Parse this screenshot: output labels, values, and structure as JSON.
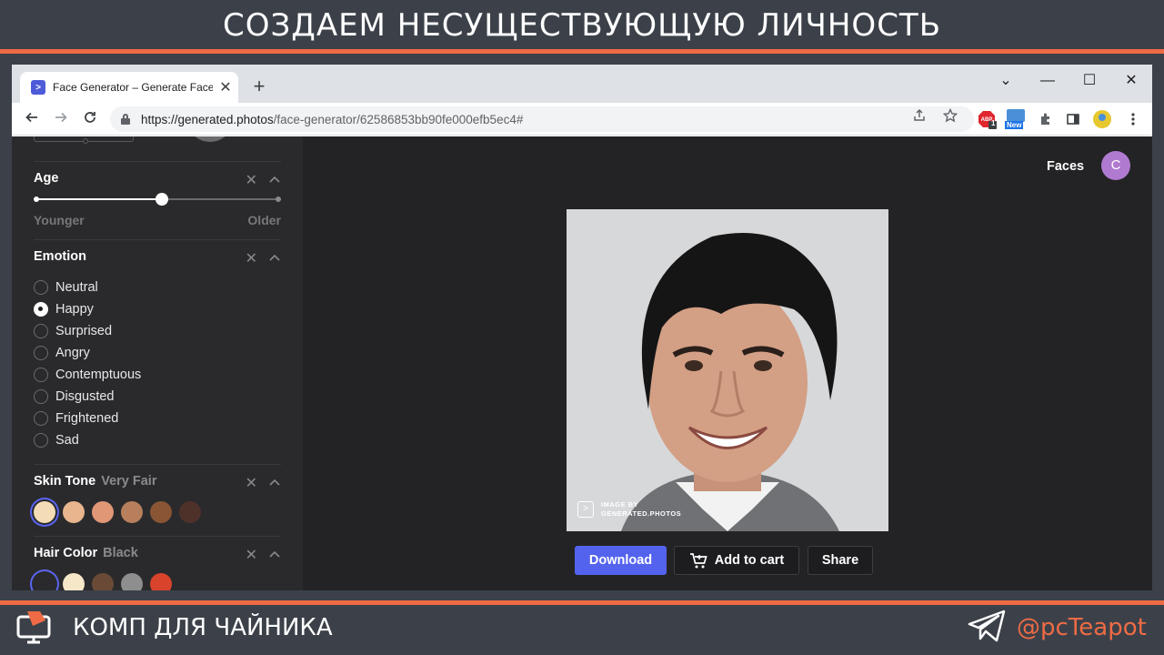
{
  "banner": {
    "title": "СОЗДАЕМ НЕСУЩЕСТВУЮЩУЮ ЛИЧНОСТЬ",
    "footer_title": "КОМП ДЛЯ ЧАЙНИКА",
    "handle": "@pcTeapot",
    "accent": "#ee6b45"
  },
  "browser": {
    "tab_title": "Face Generator – Generate Faces",
    "favicon_text": ">",
    "tab_close": "✕",
    "new_tab": "+",
    "url_host": "https://generated.photos",
    "url_path": "/face-generator/62586853bb90fe000efb5ec4#",
    "window_controls": [
      "⌄",
      "—",
      "☐",
      "✕"
    ],
    "ext_badge_abp": "1",
    "ext_badge_new": "New"
  },
  "sidebar": {
    "age": {
      "title": "Age",
      "min_label": "Younger",
      "max_label": "Older",
      "value": 0.52
    },
    "emotion": {
      "title": "Emotion",
      "options": [
        "Neutral",
        "Happy",
        "Surprised",
        "Angry",
        "Contemptuous",
        "Disgusted",
        "Frightened",
        "Sad"
      ],
      "selected": "Happy"
    },
    "skin_tone": {
      "title": "Skin Tone",
      "value": "Very Fair",
      "swatches": [
        "#f3dcb6",
        "#e9b58e",
        "#e09776",
        "#b87f5c",
        "#8a5535",
        "#4e322a"
      ],
      "selected_index": 0
    },
    "hair_color": {
      "title": "Hair Color",
      "value": "Black",
      "swatches": [
        "#2a2a2c",
        "#f6e7c9",
        "#6a4a36",
        "#8e8e8e",
        "#d8432c"
      ],
      "selected_index": 0
    }
  },
  "main": {
    "faces_link": "Faces",
    "avatar_letter": "C",
    "watermark_line1": "IMAGE BY",
    "watermark_line2": "GENERATED.PHOTOS",
    "download_label": "Download",
    "cart_label": "Add to cart",
    "share_label": "Share",
    "accent": "#5463ee"
  }
}
